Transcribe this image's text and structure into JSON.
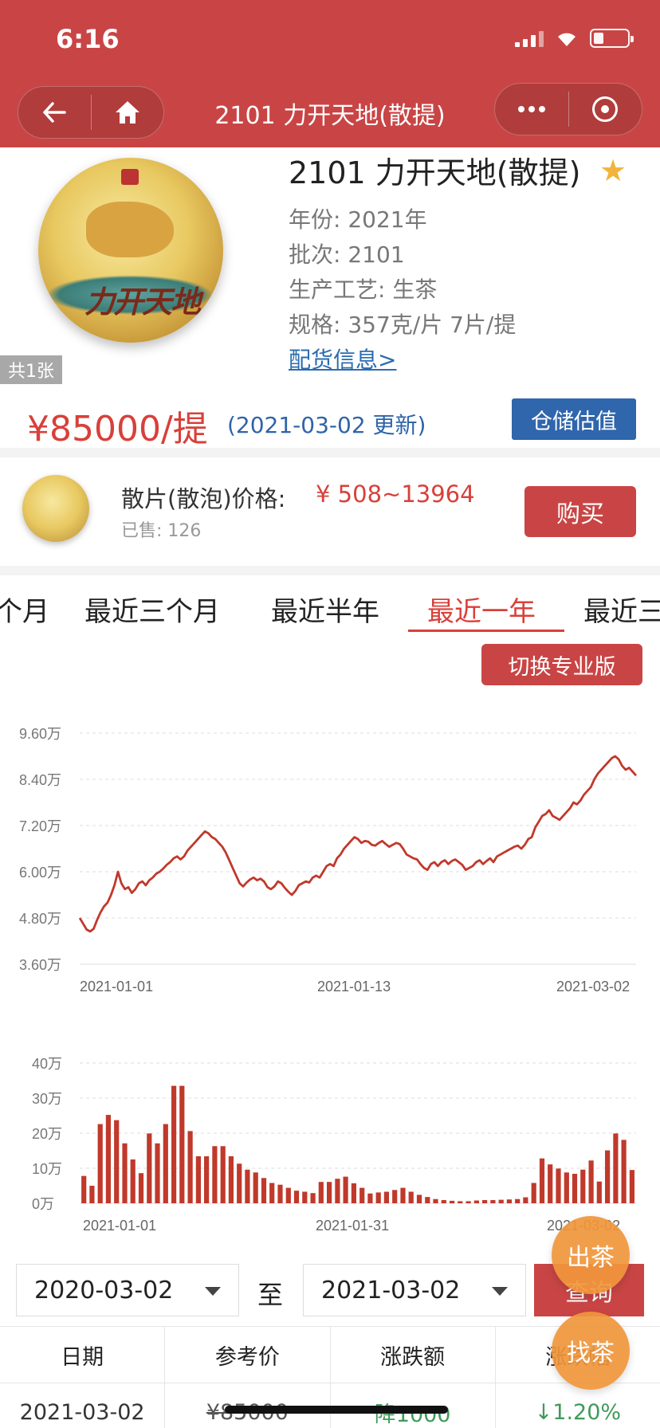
{
  "status": {
    "time": "6:16"
  },
  "nav": {
    "title": "2101 力开天地(散提)"
  },
  "product": {
    "title": "2101 力开天地(散提)",
    "photo_count": "共1张",
    "cake_text": "力开天地",
    "year": "年份: 2021年",
    "batch": "批次: 2101",
    "process": "生产工艺: 生茶",
    "spec": "规格: 357克/片 7片/提",
    "delivery_link": "配货信息>",
    "price": "¥85000/提",
    "price_date": "(2021-03-02 更新)",
    "storage_button": "仓储估值"
  },
  "loose": {
    "label": "散片(散泡)价格:",
    "price": "¥ 508~13964",
    "sold": "已售: 126",
    "buy_button": "购买"
  },
  "tabs": {
    "items": [
      "个月",
      "最近三个月",
      "最近半年",
      "最近一年",
      "最近三"
    ],
    "active_index": 3
  },
  "pro_button": "切换专业版",
  "chart_data": [
    {
      "type": "line",
      "y_ticks": [
        "9.60万",
        "8.40万",
        "7.20万",
        "6.00万",
        "4.80万",
        "3.60万"
      ],
      "x_ticks": [
        "2021-01-01",
        "2021-01-13",
        "2021-03-02"
      ],
      "ylim": [
        36000,
        96000
      ],
      "color": "#c0392b",
      "series": [
        {
          "values": [
            48000,
            46500,
            45000,
            44500,
            45200,
            47500,
            49500,
            51000,
            52000,
            54000,
            56500,
            60000,
            57000,
            55500,
            56000,
            54500,
            55500,
            57000,
            57500,
            56500,
            57800,
            58500,
            59500,
            60000,
            60800,
            61800,
            62500,
            63500,
            64000,
            63200,
            64000,
            65500,
            66500,
            67500,
            68500,
            69500,
            70500,
            70000,
            69000,
            68500,
            67500,
            66500,
            65000,
            63000,
            61000,
            59000,
            57000,
            56200,
            57200,
            58000,
            58500,
            57800,
            58200,
            57500,
            56000,
            55500,
            56200,
            57500,
            57000,
            55800,
            54800,
            54000,
            55000,
            56500,
            57000,
            57500,
            57200,
            58500,
            59000,
            58500,
            60000,
            61500,
            62000,
            61500,
            63500,
            64500,
            66000,
            67000,
            68000,
            69000,
            68500,
            67500,
            68000,
            67800,
            67000,
            66800,
            67500,
            68000,
            67200,
            66500,
            67000,
            67500,
            67200,
            66000,
            64500,
            64000,
            63500,
            63200,
            62000,
            61000,
            60500,
            62000,
            62500,
            61500,
            62500,
            63000,
            62000,
            62800,
            63200,
            62500,
            61800,
            60500,
            61000,
            61500,
            62500,
            63000,
            62000,
            62800,
            63500,
            62500,
            64000,
            64500,
            65000,
            65500,
            66000,
            66500,
            66800,
            66000,
            67000,
            68500,
            69000,
            71500,
            73000,
            74500,
            75000,
            76000,
            74500,
            74000,
            73500,
            74500,
            75500,
            76500,
            78000,
            77500,
            78500,
            80000,
            81000,
            82000,
            84000,
            85500,
            86500,
            87500,
            88500,
            89500,
            90000,
            89200,
            87500,
            86500,
            87000,
            86000,
            85000
          ]
        }
      ]
    },
    {
      "type": "bar",
      "y_ticks": [
        "40万",
        "30万",
        "20万",
        "10万",
        "0万"
      ],
      "x_ticks": [
        "2021-01-01",
        "2021-01-31",
        "2021-03-02"
      ],
      "ylim": [
        0,
        400000
      ],
      "color": "#c0392b",
      "series": [
        {
          "values": [
            78000,
            50000,
            226000,
            252000,
            237000,
            171000,
            125000,
            86000,
            199000,
            171000,
            226000,
            335000,
            335000,
            206000,
            134000,
            134000,
            163000,
            163000,
            134000,
            113000,
            96000,
            88000,
            72000,
            58000,
            53000,
            44000,
            36000,
            33000,
            29000,
            61000,
            61000,
            70000,
            76000,
            57000,
            44000,
            28000,
            31000,
            33000,
            38000,
            44000,
            33000,
            24000,
            18000,
            12000,
            9000,
            7000,
            6000,
            6000,
            8000,
            9000,
            9000,
            10000,
            11000,
            12000,
            17000,
            58000,
            128000,
            111000,
            99000,
            88000,
            84000,
            96000,
            122000,
            62000,
            151000,
            199000,
            181000,
            95000
          ]
        }
      ]
    }
  ],
  "date_range": {
    "from": "2020-03-02",
    "to_label": "至",
    "to": "2021-03-02",
    "query_button": "查询"
  },
  "table": {
    "headers": [
      "日期",
      "参考价",
      "涨跌额",
      "涨跌幅"
    ],
    "row": {
      "date": "2021-03-02",
      "price": "¥85000",
      "change": "降1000",
      "pct": "↓1.20%"
    }
  },
  "floating": {
    "sell": "出茶",
    "find": "找茶"
  },
  "colors": {
    "brand_red": "#c94545",
    "price_red": "#d8403a",
    "blue": "#2f66ac",
    "star": "#f1b33a",
    "float_orange": "#f0963c"
  }
}
